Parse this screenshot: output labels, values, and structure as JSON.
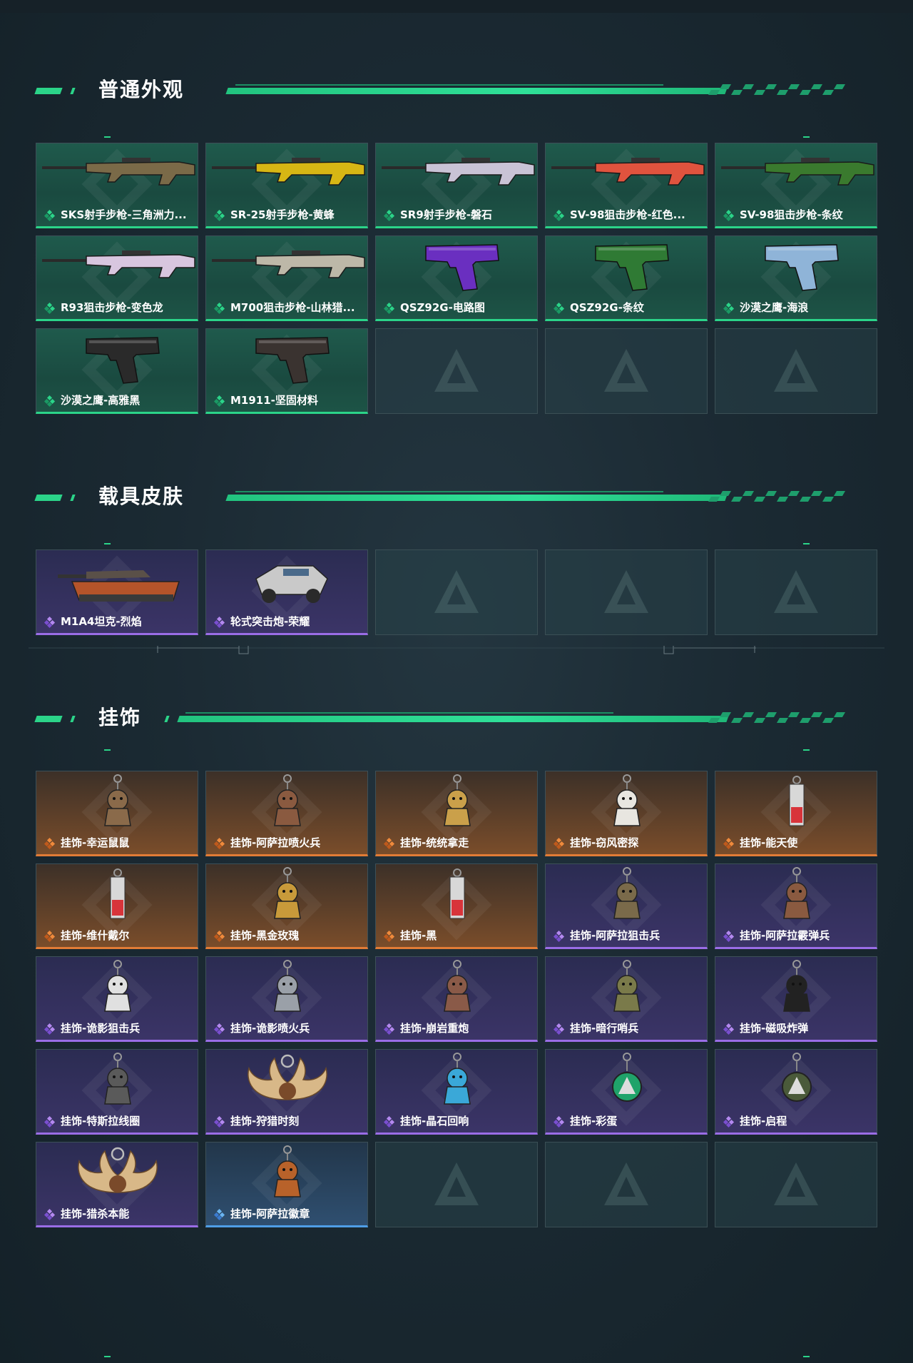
{
  "sections": [
    {
      "title": "普通外观",
      "items": [
        {
          "label": "SKS射手步枪-三角洲力...",
          "rarity": "green",
          "icon": "rifle-icon",
          "color": "#7a6a48",
          "kind": "rifle"
        },
        {
          "label": "SR-25射手步枪-黄蜂",
          "rarity": "green",
          "icon": "rifle-icon",
          "color": "#d7b614",
          "kind": "rifle"
        },
        {
          "label": "SR9射手步枪-磐石",
          "rarity": "green",
          "icon": "rifle-icon",
          "color": "#c9c3d6",
          "kind": "rifle"
        },
        {
          "label": "SV-98狙击步枪-红色...",
          "rarity": "green",
          "icon": "sniper-icon",
          "color": "#e0533e",
          "kind": "rifle"
        },
        {
          "label": "SV-98狙击步枪-条纹",
          "rarity": "green",
          "icon": "sniper-icon",
          "color": "#3a7a2e",
          "kind": "rifle"
        },
        {
          "label": "R93狙击步枪-变色龙",
          "rarity": "green",
          "icon": "sniper-icon",
          "color": "#d8c6df",
          "kind": "rifle"
        },
        {
          "label": "M700狙击步枪-山林猎...",
          "rarity": "green",
          "icon": "sniper-icon",
          "color": "#bdb8a8",
          "kind": "rifle"
        },
        {
          "label": "QSZ92G-电路图",
          "rarity": "green",
          "icon": "pistol-icon",
          "color": "#6a2fc0",
          "kind": "pistol"
        },
        {
          "label": "QSZ92G-条纹",
          "rarity": "green",
          "icon": "pistol-icon",
          "color": "#2f7a34",
          "kind": "pistol"
        },
        {
          "label": "沙漠之鹰-海浪",
          "rarity": "green",
          "icon": "pistol-icon",
          "color": "#8fb4d8",
          "kind": "pistol"
        },
        {
          "label": "沙漠之鹰-高雅黑",
          "rarity": "green",
          "icon": "pistol-icon",
          "color": "#2a2a2a",
          "kind": "pistol"
        },
        {
          "label": "M1911-坚固材料",
          "rarity": "green",
          "icon": "pistol-icon",
          "color": "#3a3330",
          "kind": "pistol"
        }
      ]
    },
    {
      "title": "载具皮肤",
      "items": [
        {
          "label": "M1A4坦克-烈焰",
          "rarity": "purple",
          "icon": "tank-icon",
          "color": "#b5542a",
          "kind": "tank"
        },
        {
          "label": "轮式突击炮-荣耀",
          "rarity": "purple",
          "icon": "vehicle-icon",
          "color": "#c9c9c9",
          "kind": "car"
        }
      ]
    },
    {
      "title": "挂饰",
      "items": [
        {
          "label": "挂饰-幸运鼠鼠",
          "rarity": "orange",
          "icon": "charm-icon",
          "color": "#8a6a4a",
          "kind": "charm"
        },
        {
          "label": "挂饰-阿萨拉喷火兵",
          "rarity": "orange",
          "icon": "charm-icon",
          "color": "#8a5a40",
          "kind": "charm"
        },
        {
          "label": "挂饰-统统拿走",
          "rarity": "orange",
          "icon": "charm-icon",
          "color": "#caa04a",
          "kind": "charm"
        },
        {
          "label": "挂饰-窃风密探",
          "rarity": "orange",
          "icon": "charm-icon",
          "color": "#e8e6e0",
          "kind": "charm"
        },
        {
          "label": "挂饰-能天使",
          "rarity": "orange",
          "icon": "charm-icon",
          "color": "#d8d8d8",
          "kind": "tag"
        },
        {
          "label": "挂饰-维什戴尔",
          "rarity": "orange",
          "icon": "charm-icon",
          "color": "#d8d8d8",
          "kind": "tag"
        },
        {
          "label": "挂饰-黑金玫瑰",
          "rarity": "orange",
          "icon": "charm-icon",
          "color": "#c89a3a",
          "kind": "charm"
        },
        {
          "label": "挂饰-黑",
          "rarity": "orange",
          "icon": "charm-icon",
          "color": "#d8d8d8",
          "kind": "tag"
        },
        {
          "label": "挂饰-阿萨拉狙击兵",
          "rarity": "purple",
          "icon": "charm-icon",
          "color": "#7a6a4a",
          "kind": "charm"
        },
        {
          "label": "挂饰-阿萨拉霰弹兵",
          "rarity": "purple",
          "icon": "charm-icon",
          "color": "#8a5a40",
          "kind": "charm"
        },
        {
          "label": "挂饰-诡影狙击兵",
          "rarity": "purple",
          "icon": "charm-icon",
          "color": "#e0e0e0",
          "kind": "charm"
        },
        {
          "label": "挂饰-诡影喷火兵",
          "rarity": "purple",
          "icon": "charm-icon",
          "color": "#9aa0a8",
          "kind": "charm"
        },
        {
          "label": "挂饰-崩岩重炮",
          "rarity": "purple",
          "icon": "charm-icon",
          "color": "#8a5a48",
          "kind": "charm"
        },
        {
          "label": "挂饰-暗行哨兵",
          "rarity": "purple",
          "icon": "charm-icon",
          "color": "#7a7a4a",
          "kind": "charm"
        },
        {
          "label": "挂饰-磁吸炸弹",
          "rarity": "purple",
          "icon": "charm-icon",
          "color": "#222222",
          "kind": "charm"
        },
        {
          "label": "挂饰-特斯拉线圈",
          "rarity": "purple",
          "icon": "charm-icon",
          "color": "#5a5a5a",
          "kind": "charm"
        },
        {
          "label": "挂饰-狩猎时刻",
          "rarity": "purple",
          "icon": "antler-icon",
          "color": "#d8b888",
          "kind": "antler"
        },
        {
          "label": "挂饰-晶石回响",
          "rarity": "purple",
          "icon": "charm-icon",
          "color": "#3aa8d8",
          "kind": "charm"
        },
        {
          "label": "挂饰-彩蛋",
          "rarity": "purple",
          "icon": "charm-icon",
          "color": "#1fa36a",
          "kind": "emblem"
        },
        {
          "label": "挂饰-启程",
          "rarity": "purple",
          "icon": "charm-icon",
          "color": "#4a5a3a",
          "kind": "emblem"
        },
        {
          "label": "挂饰-猎杀本能",
          "rarity": "purple",
          "icon": "antler-icon",
          "color": "#d8b888",
          "kind": "antler"
        },
        {
          "label": "挂饰-阿萨拉徽章",
          "rarity": "blue",
          "icon": "badge-icon",
          "color": "#b8622a",
          "kind": "charm"
        }
      ]
    }
  ],
  "colors": {
    "accent": "#2bd489",
    "green": "#2bd489",
    "purple": "#9a6de6",
    "orange": "#e27c36",
    "blue": "#4f9ee6"
  }
}
